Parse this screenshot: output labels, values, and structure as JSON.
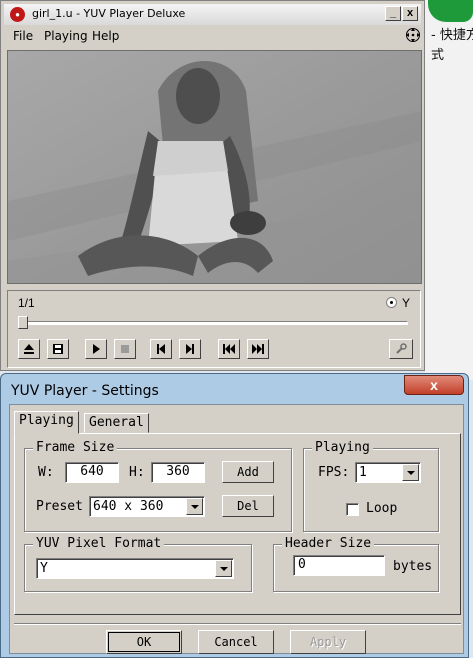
{
  "desktop": {
    "side_text": "- 快捷方\n式"
  },
  "player": {
    "title": "girl_1.u - YUV Player Deluxe",
    "app_icon": "record-icon",
    "window_buttons": {
      "minimize": "_",
      "close": "x"
    },
    "menu": [
      {
        "label": "File",
        "mnemonic": "F"
      },
      {
        "label": "Playing",
        "mnemonic": "P"
      },
      {
        "label": "Help",
        "mnemonic": "H"
      }
    ],
    "frame_counter": "1/1",
    "channel_label": "Y",
    "controls": [
      "eject-icon",
      "save-icon",
      "play-icon",
      "stop-icon",
      "prev-frame-icon",
      "next-frame-icon",
      "skip-start-icon",
      "skip-end-icon",
      "settings-wrench-icon"
    ]
  },
  "settings": {
    "title": "YUV Player - Settings",
    "close_label": "x",
    "tabs": [
      {
        "label": "Playing",
        "active": true
      },
      {
        "label": "General",
        "active": false
      }
    ],
    "frame_size": {
      "title": "Frame Size",
      "width_label": "W:",
      "width_value": "640",
      "height_label": "H:",
      "height_value": "360",
      "add_label": "Add",
      "preset_label": "Preset",
      "preset_value": "640 x 360",
      "del_label": "Del"
    },
    "playing": {
      "title": "Playing",
      "fps_label": "FPS:",
      "fps_value": "1",
      "loop_label": "Loop",
      "loop_checked": false
    },
    "pixel_format": {
      "title": "YUV Pixel Format",
      "value": "Y"
    },
    "header": {
      "title": "Header Size",
      "value": "0",
      "unit": "bytes"
    },
    "buttons": {
      "ok": "OK",
      "cancel": "Cancel",
      "apply": "Apply"
    }
  },
  "colors": {
    "dialog_frame": "#aecbe6",
    "close_red": "#c2402a",
    "face": "#d4d0c8",
    "video_bg": "#9e9e9e"
  }
}
